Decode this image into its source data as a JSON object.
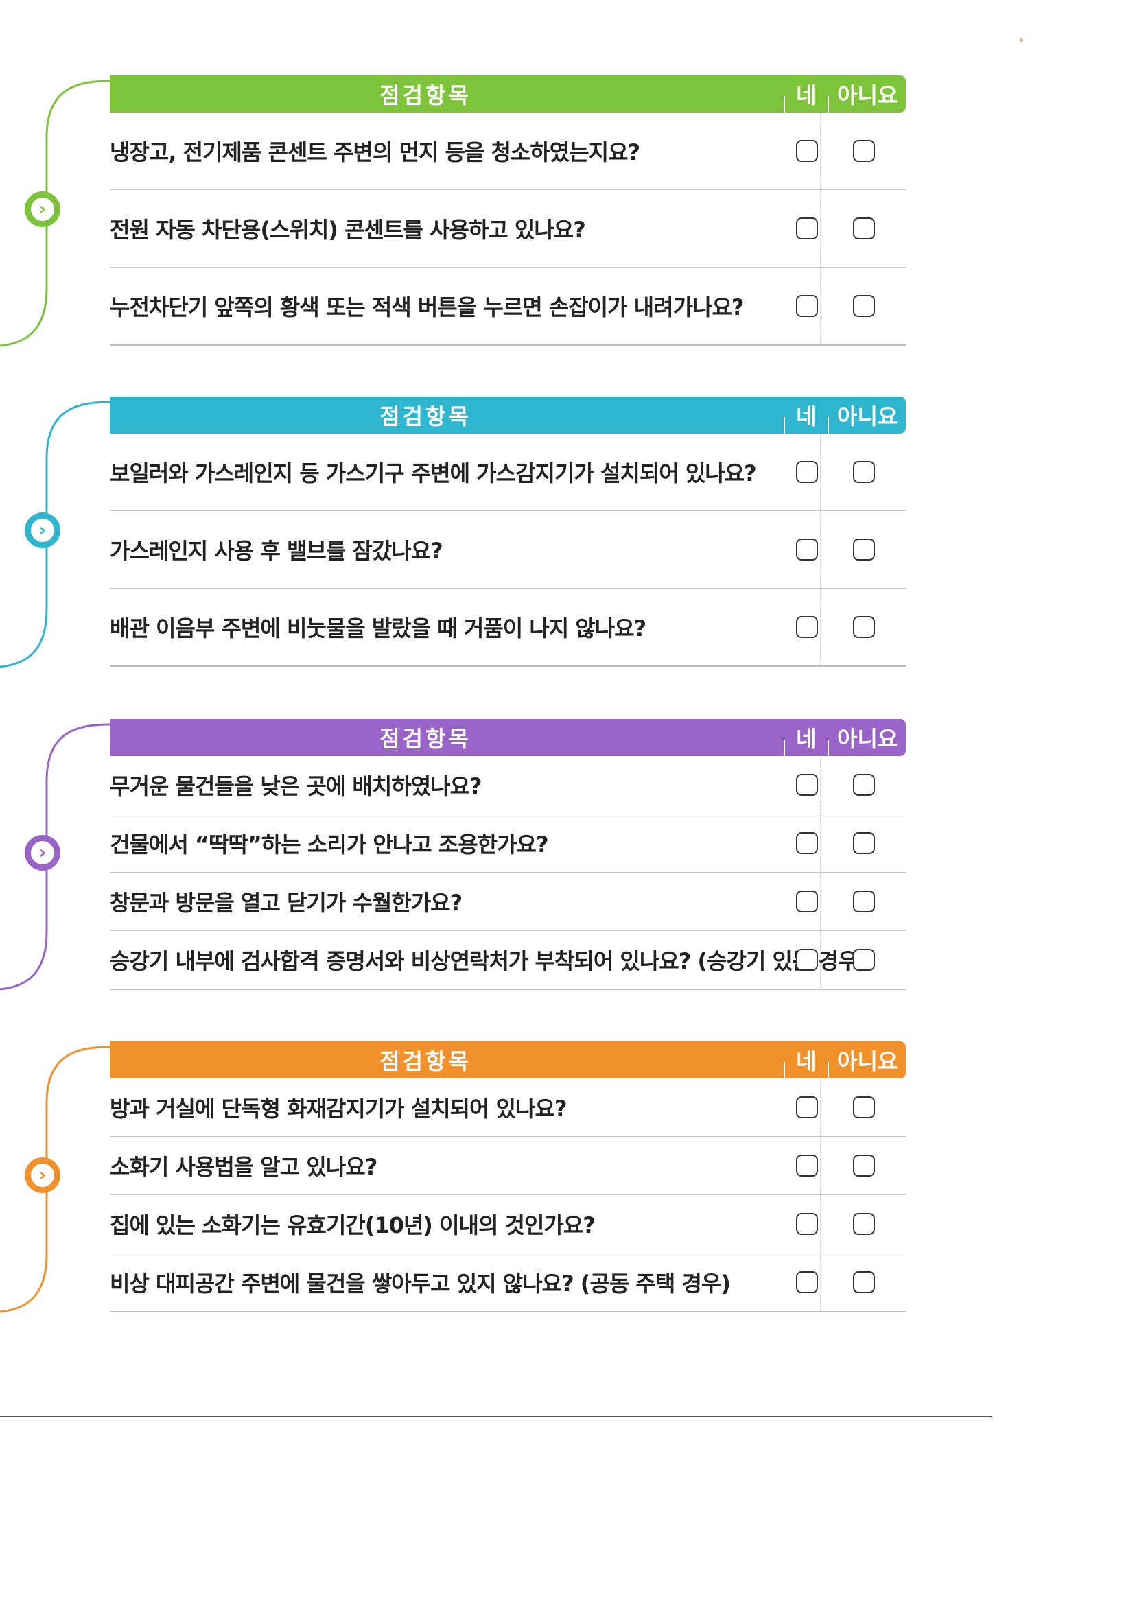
{
  "sections": [
    {
      "color": "#7ec43a",
      "header": {
        "title": "점검항목",
        "yes_label": "네",
        "no_label": "아니요"
      },
      "questions": [
        "냉장고, 전기제품 콘센트 주변의 먼지 등을 청소하였는지요?",
        "전원 자동 차단용(스위치) 콘센트를 사용하고 있나요?",
        "누전차단기 앞쪽의 황색 또는 적색 버튼을 누르면 손잡이가 내려가나요?"
      ]
    },
    {
      "color": "#2fb6cf",
      "header": {
        "title": "점검항목",
        "yes_label": "네",
        "no_label": "아니요"
      },
      "questions": [
        "보일러와 가스레인지 등 가스기구 주변에 가스감지기가 설치되어 있나요?",
        "가스레인지 사용 후 밸브를 잠갔나요?",
        "배관 이음부 주변에 비눗물을 발랐을 때 거품이 나지 않나요?"
      ]
    },
    {
      "color": "#9a63c8",
      "header": {
        "title": "점검항목",
        "yes_label": "네",
        "no_label": "아니요"
      },
      "questions": [
        "무거운 물건들을 낮은 곳에 배치하였나요?",
        "건물에서 “딱딱”하는 소리가 안나고 조용한가요?",
        "창문과 방문을 열고 닫기가 수월한가요?",
        "승강기 내부에 검사합격 증명서와 비상연락처가 부착되어 있나요? (승강기 있는 경우)"
      ]
    },
    {
      "color": "#f0912c",
      "header": {
        "title": "점검항목",
        "yes_label": "네",
        "no_label": "아니요"
      },
      "questions": [
        "방과 거실에 단독형 화재감지기가 설치되어 있나요?",
        "소화기 사용법을 알고 있나요?",
        "집에 있는 소화기는 유효기간(10년) 이내의 것인가요?",
        "비상 대피공간 주변에 물건을 쌓아두고 있지 않나요? (공동 주택 경우)"
      ]
    }
  ]
}
